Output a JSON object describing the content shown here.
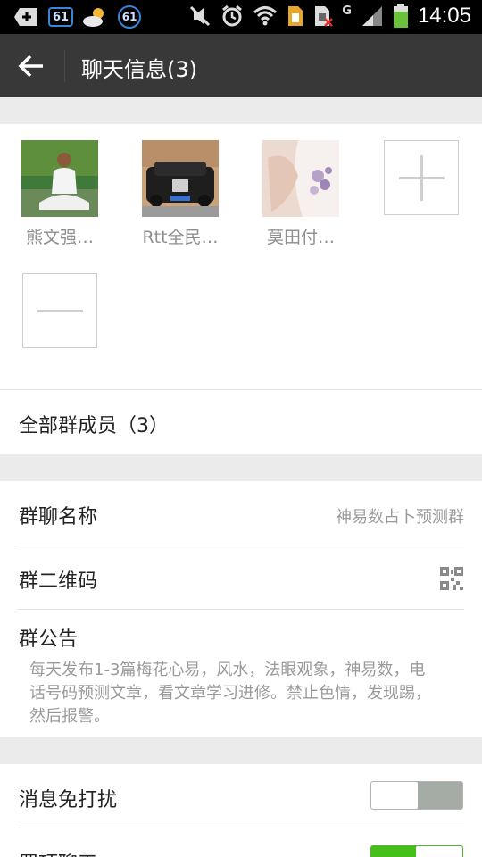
{
  "status_bar": {
    "badge_1": "61",
    "badge_2": "61",
    "network": "G",
    "time": "14:05",
    "icons": [
      "add-icon",
      "weather-icon",
      "mute-icon",
      "alarm-icon",
      "wifi-icon",
      "sim-icon",
      "sim-icon",
      "signal-icon",
      "battery-icon"
    ]
  },
  "header": {
    "title": "聊天信息(3)",
    "back_icon": "arrow-left-icon"
  },
  "members": [
    {
      "name": "熊文强…"
    },
    {
      "name": "Rtt全民…"
    },
    {
      "name": "莫田付…"
    }
  ],
  "all_members_label": "全部群成员（3）",
  "group_info": {
    "name_label": "群聊名称",
    "name_value": "神易数占卜预测群",
    "qr_label": "群二维码",
    "notice_label": "群公告",
    "notice_text": "每天发布1-3篇梅花心易，风水，法眼观象，神易数，电话号码预测文章，看文章学习进修。禁止色情，发现踢，然后报警。"
  },
  "settings": {
    "mute_label": "消息免打扰",
    "mute_on": false,
    "pin_label": "置顶聊天",
    "pin_on": true
  },
  "colors": {
    "header_bg": "#383838",
    "toggle_on": "#45c01a",
    "toggle_off": "#a5aca5"
  }
}
